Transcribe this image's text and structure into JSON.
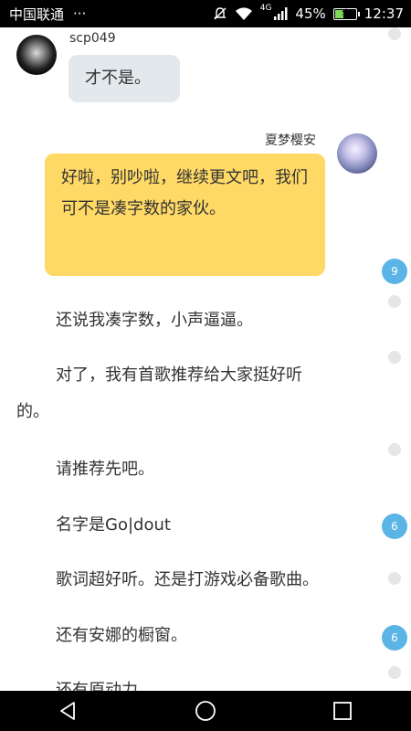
{
  "status_bar": {
    "carrier": "中国联通",
    "more": "···",
    "network": "4G",
    "battery_percent": "45%",
    "battery_level": 0.45,
    "time": "12:37"
  },
  "messages": {
    "left": {
      "sender": "scp049",
      "text": "才不是。"
    },
    "right": {
      "sender": "夏梦樱安",
      "text": "好啦，别吵啦，继续更文吧，我们可不是凑字数的家伙。"
    }
  },
  "story": {
    "p1": "还说我凑字数，小声逼逼。",
    "p2_line1": "对了，我有首歌推荐给大家挺好听",
    "p2_line2": "的。",
    "p3": "请推荐先吧。",
    "p4": "名字是Go|dout",
    "p5": "歌词超好听。还是打游戏必备歌曲。",
    "p6": "还有安娜的橱窗。",
    "p7": "还有原动力"
  },
  "comment_badges": {
    "b1": "9",
    "b2": "6",
    "b3": "6"
  },
  "icons": {
    "mute": "mute-icon",
    "wifi": "wifi-icon",
    "signal": "signal-icon",
    "battery": "battery-icon",
    "back": "back-icon",
    "home": "home-icon",
    "recents": "recents-icon"
  },
  "colors": {
    "yellow_bubble": "#ffd966",
    "grey_bubble": "#e3e8ec",
    "badge": "#5ab4e5"
  }
}
